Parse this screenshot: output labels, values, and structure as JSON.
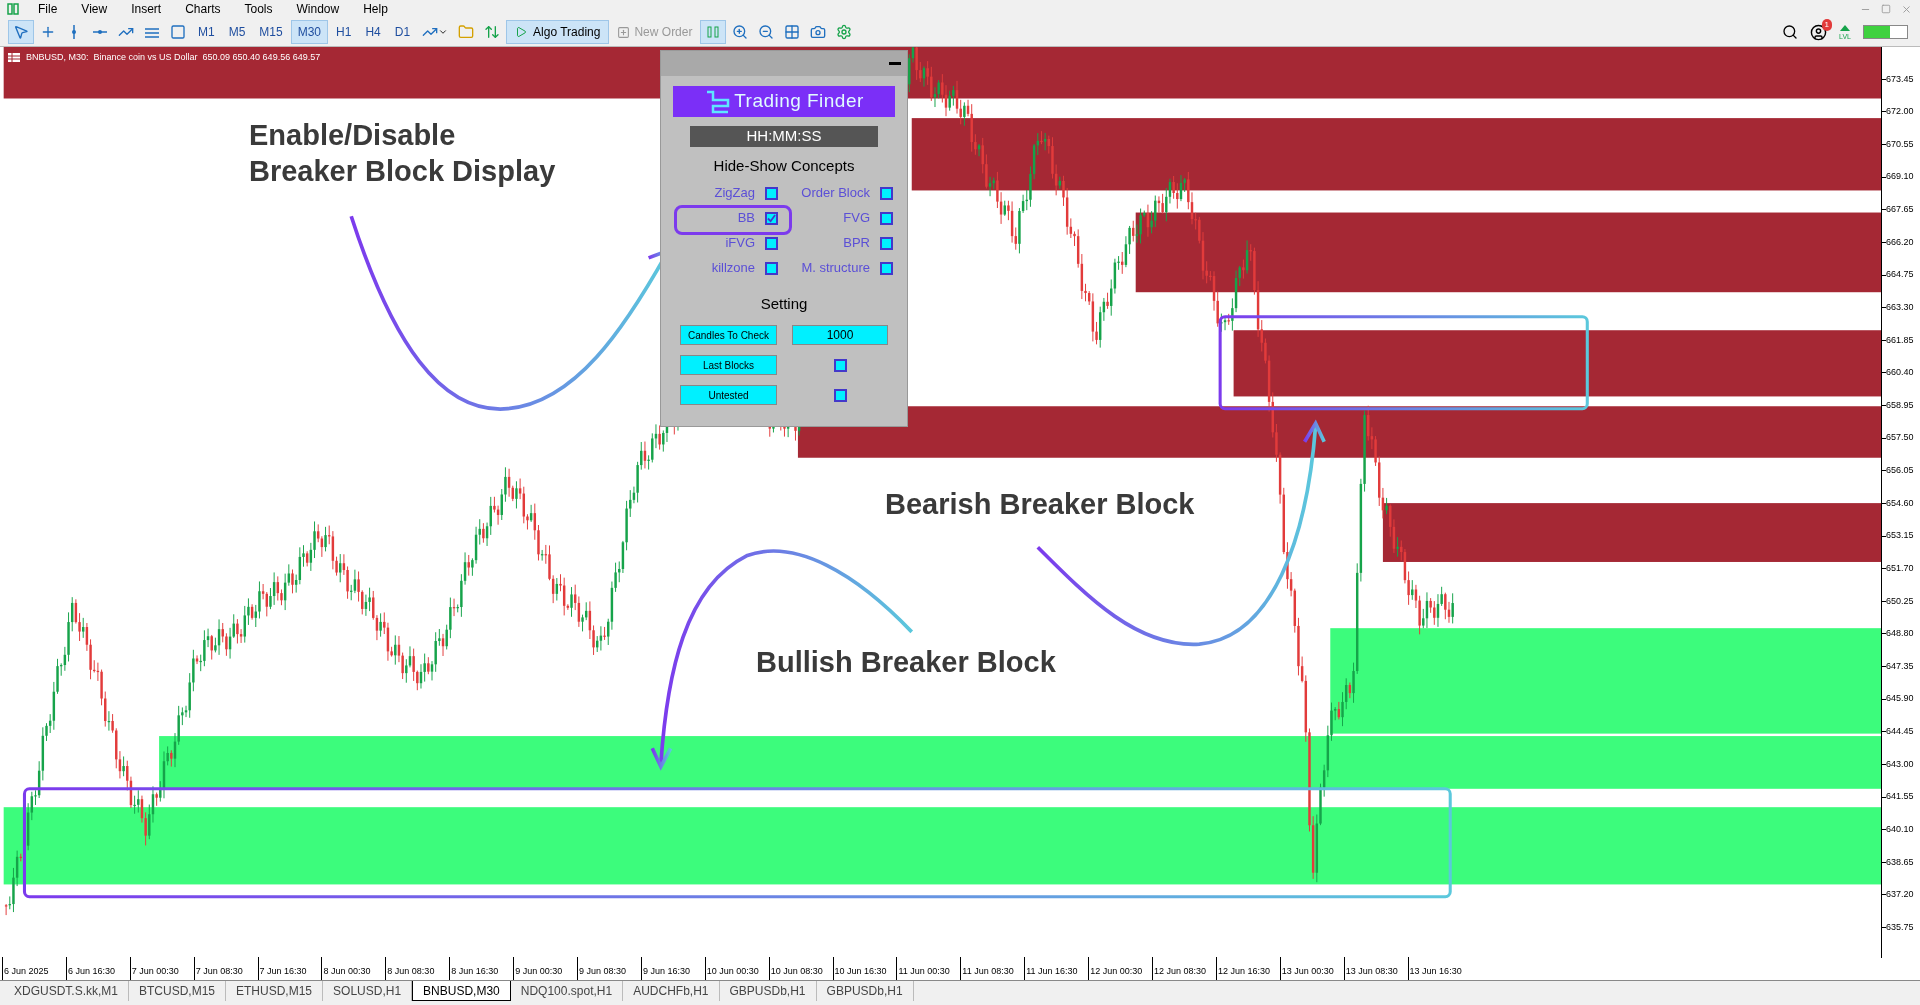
{
  "menu": [
    "File",
    "View",
    "Insert",
    "Charts",
    "Tools",
    "Window",
    "Help"
  ],
  "toolbar": {
    "timeframes": [
      {
        "label": "M1",
        "selected": false
      },
      {
        "label": "M5",
        "selected": false
      },
      {
        "label": "M15",
        "selected": false
      },
      {
        "label": "M30",
        "selected": true
      },
      {
        "label": "H1",
        "selected": false
      },
      {
        "label": "H4",
        "selected": false
      },
      {
        "label": "D1",
        "selected": false
      }
    ],
    "algo_trading": {
      "label": "Algo Trading",
      "on": true
    },
    "new_order": {
      "label": "New Order",
      "disabled": true
    },
    "notification_count": "1",
    "level_label": "LVL"
  },
  "chart": {
    "info": "BNBUSD, M30:  Binance coin vs US Dollar  650.09 650.40 649.56 649.57",
    "price_axis": [
      "673.45",
      "672.00",
      "670.55",
      "669.10",
      "667.65",
      "666.20",
      "664.75",
      "663.30",
      "661.85",
      "660.40",
      "658.95",
      "657.50",
      "656.05",
      "654.60",
      "653.15",
      "651.70",
      "650.25",
      "648.80",
      "647.35",
      "645.90",
      "644.45",
      "643.00",
      "641.55",
      "640.10",
      "638.65",
      "637.20",
      "635.75"
    ],
    "time_axis": [
      "6 Jun 2025",
      "6 Jun 16:30",
      "7 Jun 00:30",
      "7 Jun 08:30",
      "7 Jun 16:30",
      "8 Jun 00:30",
      "8 Jun 08:30",
      "8 Jun 16:30",
      "9 Jun 00:30",
      "9 Jun 08:30",
      "9 Jun 16:30",
      "10 Jun 00:30",
      "10 Jun 08:30",
      "10 Jun 16:30",
      "11 Jun 00:30",
      "11 Jun 08:30",
      "11 Jun 16:30",
      "12 Jun 00:30",
      "12 Jun 08:30",
      "12 Jun 16:30",
      "13 Jun 00:30",
      "13 Jun 08:30",
      "13 Jun 16:30"
    ],
    "annotations": [
      {
        "lines": [
          "Enable/Disable",
          "Breaker Block Display"
        ]
      },
      {
        "lines": [
          "Bearish Breaker Block"
        ]
      },
      {
        "lines": [
          "Bullish Breaker Block"
        ]
      }
    ]
  },
  "panel": {
    "brand": "Trading Finder",
    "clock": "HH:MM:SS",
    "concepts_title": "Hide-Show Concepts",
    "concepts": [
      {
        "label": "ZigZag",
        "checked": false
      },
      {
        "label": "Order Block",
        "checked": false
      },
      {
        "label": "BB",
        "checked": true
      },
      {
        "label": "FVG",
        "checked": false
      },
      {
        "label": "iFVG",
        "checked": false
      },
      {
        "label": "BPR",
        "checked": false
      },
      {
        "label": "killzone",
        "checked": false
      },
      {
        "label": "M. structure",
        "checked": false
      }
    ],
    "settings_title": "Setting",
    "settings": [
      {
        "kind": "input",
        "label": "Candles To Check",
        "value": "1000"
      },
      {
        "kind": "checkbox",
        "label": "Last Blocks",
        "checked": false
      },
      {
        "kind": "checkbox",
        "label": "Untested",
        "checked": false
      }
    ]
  },
  "tabs": [
    {
      "label": "XDGUSDT.S.kk,M1",
      "selected": false
    },
    {
      "label": "BTCUSD,M15",
      "selected": false
    },
    {
      "label": "ETHUSD,M15",
      "selected": false
    },
    {
      "label": "SOLUSD,H1",
      "selected": false
    },
    {
      "label": "BNBUSD,M30",
      "selected": true
    },
    {
      "label": "NDQ100.spot,H1",
      "selected": false
    },
    {
      "label": "AUDCHFb,H1",
      "selected": false
    },
    {
      "label": "GBPUSDb,H1",
      "selected": false
    },
    {
      "label": "GBPUSDb,H1",
      "selected": false
    }
  ]
}
